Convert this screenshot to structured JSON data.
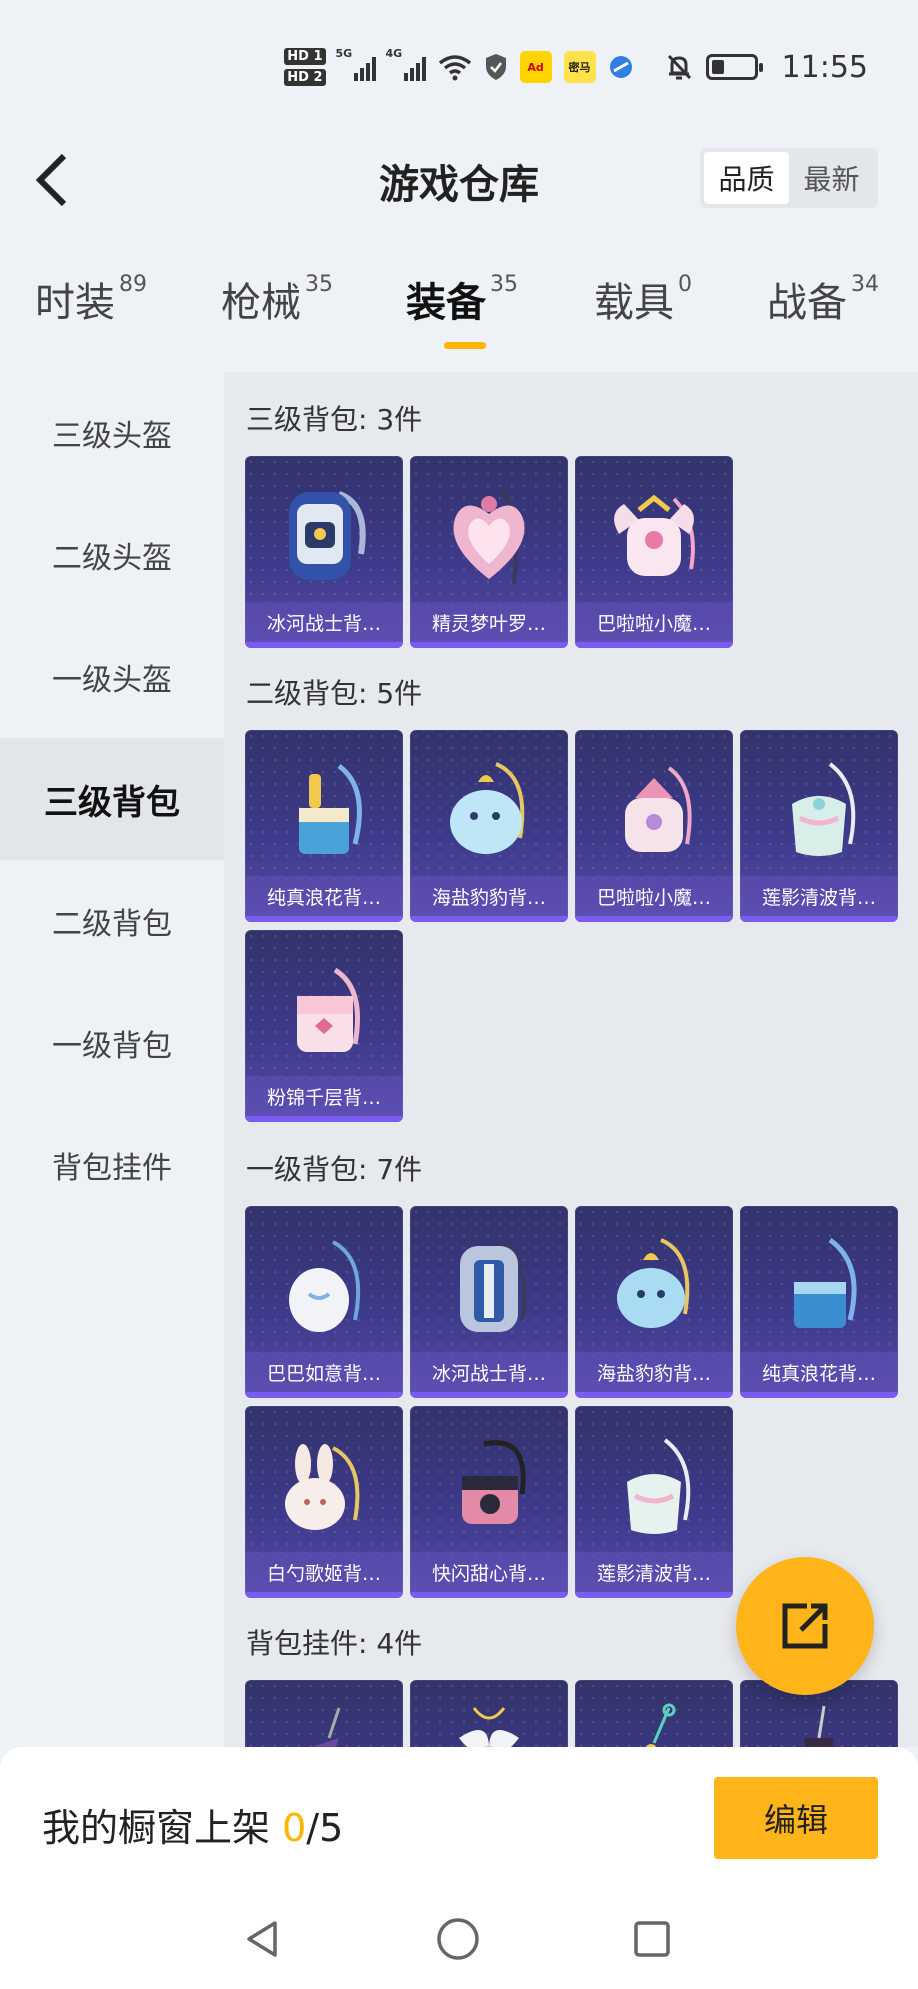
{
  "status_bar": {
    "time": "11:55",
    "hd1": "HD 1",
    "hd2": "HD 2",
    "net1": "5G",
    "net2": "4G",
    "app_badge_1": "Ad",
    "app_badge_2": "密马"
  },
  "header": {
    "title": "游戏仓库",
    "sort_options": [
      "品质",
      "最新"
    ]
  },
  "tabs": [
    {
      "label": "时装",
      "count": "89"
    },
    {
      "label": "枪械",
      "count": "35"
    },
    {
      "label": "装备",
      "count": "35"
    },
    {
      "label": "载具",
      "count": "0"
    },
    {
      "label": "战备",
      "count": "34"
    }
  ],
  "sidebar": {
    "items": [
      "三级头盔",
      "二级头盔",
      "一级头盔",
      "三级背包",
      "二级背包",
      "一级背包",
      "背包挂件"
    ]
  },
  "sections": [
    {
      "title": "三级背包: 3件",
      "items": [
        "冰河战士背…",
        "精灵梦叶罗…",
        "巴啦啦小魔…"
      ]
    },
    {
      "title": "二级背包: 5件",
      "items": [
        "纯真浪花背…",
        "海盐豹豹背…",
        "巴啦啦小魔…",
        "莲影清波背…",
        "粉锦千层背…"
      ]
    },
    {
      "title": "一级背包: 7件",
      "items": [
        "巴巴如意背…",
        "冰河战士背…",
        "海盐豹豹背…",
        "纯真浪花背…",
        "白勺歌姬背…",
        "快闪甜心背…",
        "莲影清波背…"
      ]
    },
    {
      "title": "背包挂件: 4件",
      "items": [
        "",
        "",
        "",
        ""
      ]
    }
  ],
  "bottom_bar": {
    "label": "我的橱窗上架 ",
    "current": "0",
    "total": "/5",
    "edit_label": "编辑"
  },
  "colors": {
    "accent": "#ffb41a",
    "card_top": "#32336a",
    "card_bottom": "#564aa8",
    "background": "#eef1f6"
  }
}
